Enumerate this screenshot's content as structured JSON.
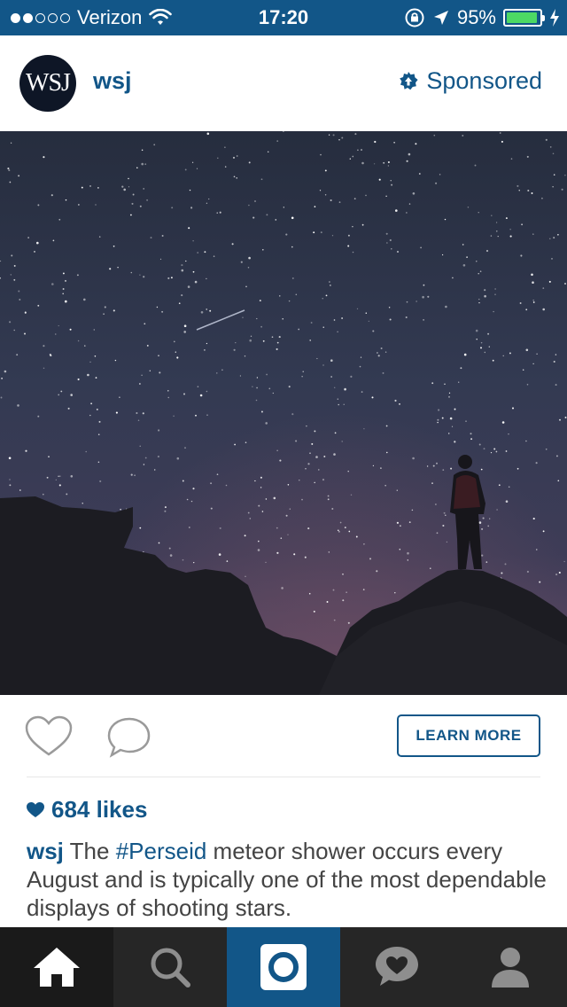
{
  "status_bar": {
    "carrier": "Verizon",
    "time": "17:20",
    "battery_percent": "95%",
    "battery_level": 0.95,
    "signal_bars_on": 2,
    "signal_bars_total": 5,
    "colors": {
      "bar": "#125688",
      "battery": "#4cd964"
    }
  },
  "post": {
    "avatar_text": "WSJ",
    "username": "wsj",
    "sponsored_label": "Sponsored",
    "cta_label": "LEARN MORE",
    "likes_label": "684 likes",
    "caption": {
      "username": "wsj",
      "text_before": " The ",
      "hashtag": "#Perseid",
      "text_after": " meteor shower occurs every August and is typically one of the most dependable displays of shooting stars."
    }
  },
  "icons": {
    "like": "heart-outline-icon",
    "comment": "comment-bubble-icon",
    "sponsored": "sponsored-badge-icon",
    "likes": "heart-filled-icon"
  },
  "tab_bar": {
    "tabs": [
      "home-icon",
      "search-icon",
      "camera-icon",
      "activity-icon",
      "profile-icon"
    ],
    "active": "home"
  },
  "colors": {
    "accent": "#125688",
    "tab_bar": "#262626",
    "text": "#444444"
  }
}
